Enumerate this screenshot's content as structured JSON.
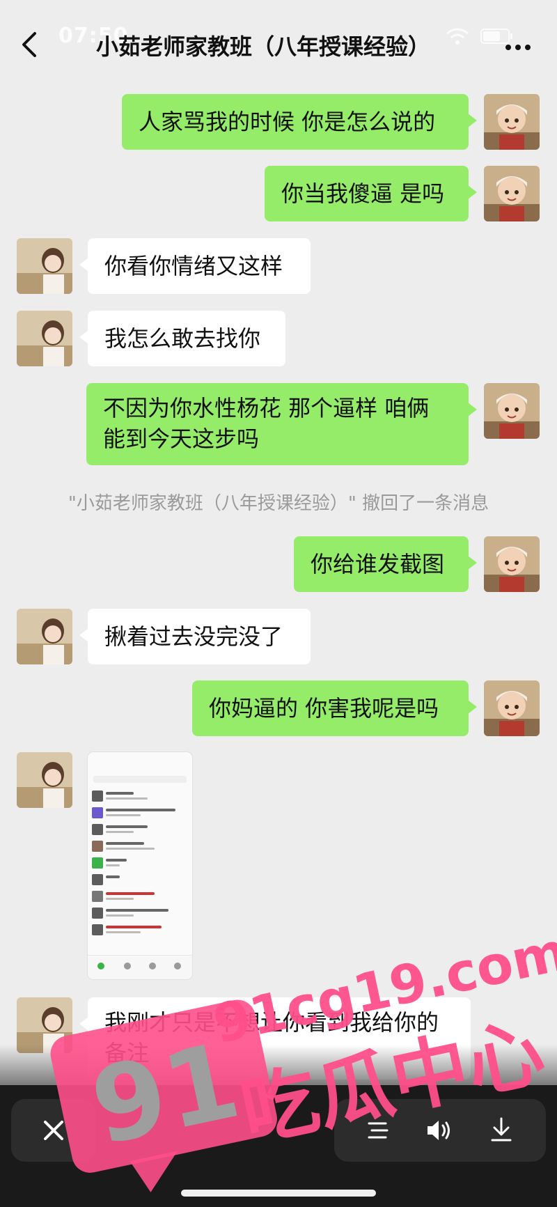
{
  "status_bar": {
    "time": "07:50"
  },
  "header": {
    "title": "小茹老师家教班（八年授课经验）"
  },
  "messages": [
    {
      "from": "self",
      "text": "人家骂我的时候 你是怎么说的"
    },
    {
      "from": "self",
      "text": "你当我傻逼 是吗"
    },
    {
      "from": "other",
      "text": "你看你情绪又这样"
    },
    {
      "from": "other",
      "text": "我怎么敢去找你"
    },
    {
      "from": "self",
      "text_line1": "不因为你水性杨花 那个逼样 咱俩",
      "text_line2": "能到今天这步吗"
    },
    {
      "from": "self",
      "text": "你给谁发截图"
    },
    {
      "from": "other",
      "text": "揪着过去没完没了"
    },
    {
      "from": "self",
      "text": "你妈逼的 你害我呢是吗"
    },
    {
      "from": "other",
      "type": "image",
      "image_desc": "chat-list-screenshot"
    },
    {
      "from": "other",
      "text_line1": "我刚才只是不想让你看到我给你的",
      "text_line2": "备注"
    }
  ],
  "system_notice": "\"小茹老师家教班（八年授课经验）\" 撤回了一条消息",
  "watermark": {
    "number": "91",
    "site": "91cg19.com",
    "name": "吃瓜中心",
    "color": "#ff4f8b"
  },
  "icons": {
    "back": "back-chevron-icon",
    "more": "more-dots-icon",
    "close": "close-icon",
    "menu": "menu-lines-icon",
    "volume": "volume-icon",
    "download": "download-icon"
  },
  "colors": {
    "self_bubble": "#95ec69",
    "other_bubble": "#ffffff",
    "background": "#ededed"
  }
}
